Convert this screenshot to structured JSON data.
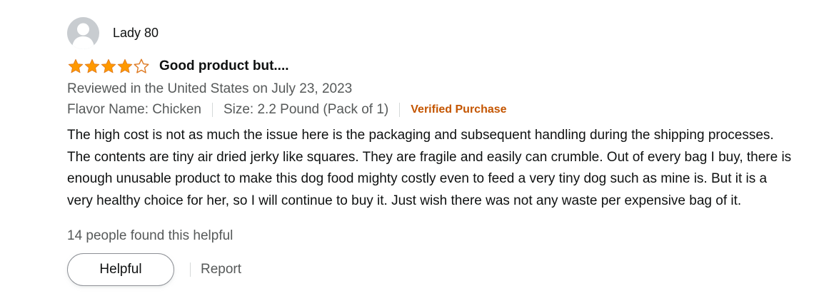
{
  "profile": {
    "name": "Lady 80",
    "avatar_icon": "user-silhouette-icon"
  },
  "review": {
    "rating": 4,
    "rating_max": 5,
    "star_color": "#ff9900",
    "star_outline_color": "#de7921",
    "title": "Good product but....",
    "date_line": "Reviewed in the United States on July 23, 2023",
    "flavor": "Flavor Name: Chicken",
    "size": "Size: 2.2 Pound (Pack of 1)",
    "verified": "Verified Purchase",
    "verified_color": "#c45500",
    "body": "The high cost is not as much the issue here is the packaging and subsequent handling during the shipping processes. The contents are tiny air dried jerky like squares. They are fragile and easily can crumble. Out of every bag I buy, there is enough unusable product to make this dog food mighty costly even to feed a very tiny dog such as mine is. But it is a very healthy choice for her, so I will continue to buy it. Just wish there was not any waste per expensive bag of it."
  },
  "footer": {
    "helpful_count": "14 people found this helpful",
    "helpful_label": "Helpful",
    "report_label": "Report"
  }
}
